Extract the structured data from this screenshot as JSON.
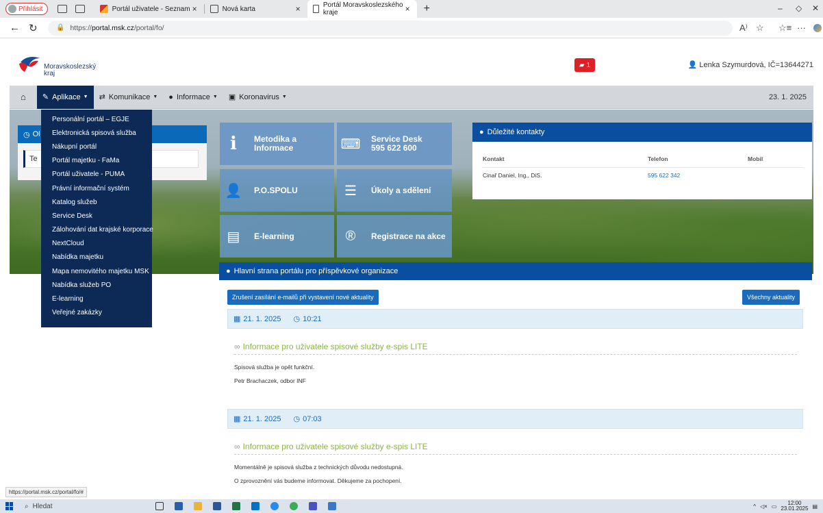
{
  "browser": {
    "profile_label": "Přihlásit",
    "tabs": [
      {
        "title": "Portál uživatele - Seznam",
        "active": false
      },
      {
        "title": "Nová karta",
        "active": false
      },
      {
        "title": "Portál Moravskoslezského kraje",
        "active": true
      }
    ],
    "url_prefix": "https://",
    "url_domain": "portal.msk.cz",
    "url_path": "/portal/fo/",
    "status_url": "https://portal.msk.cz/portal/fo/#"
  },
  "header": {
    "logo_line1": "Moravskoslezský",
    "logo_line2": "kraj",
    "badge_count": "1",
    "user": "Lenka Szymurdová, IČ=13644271"
  },
  "nav": {
    "items": [
      {
        "label": "Aplikace"
      },
      {
        "label": "Komunikace"
      },
      {
        "label": "Informace"
      },
      {
        "label": "Koronavirus"
      }
    ],
    "date": "23. 1. 2025"
  },
  "dropdown": [
    "Personální portál – EGJE",
    "Elektronická spisová služba",
    "Nákupní portál",
    "Portál majetku - FaMa",
    "Portál uživatele - PUMA",
    "Právní informační systém",
    "Katalog služeb",
    "Service Desk",
    "Zálohování dat krajské korporace",
    "NextCloud",
    "Nabídka majetku",
    "Mapa nemovitého majetku MSK",
    "Nabídka služeb PO",
    "E-learning",
    "Veřejné zakázky"
  ],
  "left_widget": {
    "head": "Ol",
    "input": "Te"
  },
  "tiles": [
    {
      "title": "Metodika a Informace"
    },
    {
      "title": "Service Desk 595 622 600"
    },
    {
      "title": "P.O.SPOLU"
    },
    {
      "title": "Úkoly a sdělení"
    },
    {
      "title": "E-learning"
    },
    {
      "title": "Registrace na akce"
    }
  ],
  "contacts": {
    "title": "Důležité kontakty",
    "cols": [
      "Kontakt",
      "Telefon",
      "Mobil"
    ],
    "row": {
      "name": "Cinař Daniel, Ing., DiS.",
      "phone": "595 622 342",
      "mobile": ""
    }
  },
  "main": {
    "title": "Hlavní strana portálu pro příspěvkové organizace",
    "unsubscribe_btn": "Zrušení zasílání e-mailů při vystavení nové aktuality",
    "all_news_btn": "Všechny aktuality",
    "news": [
      {
        "date": "21. 1. 2025",
        "time": "10:21",
        "title": "Informace pro uživatele spisové služby e-spis LITE",
        "lines": [
          "Spisová služba je opět funkční.",
          "Petr Brachaczek, odbor INF"
        ]
      },
      {
        "date": "21. 1. 2025",
        "time": "07:03",
        "title": "Informace pro uživatele spisové služby e-spis LITE",
        "lines": [
          "Momentálně je spisová služba z technických důvodu nedostupná.",
          "O zprovoznění vás budeme informovat. Děkujeme za pochopení."
        ]
      }
    ]
  },
  "taskbar": {
    "search": "Hledat",
    "time": "12:00",
    "date": "23.01.2025"
  }
}
